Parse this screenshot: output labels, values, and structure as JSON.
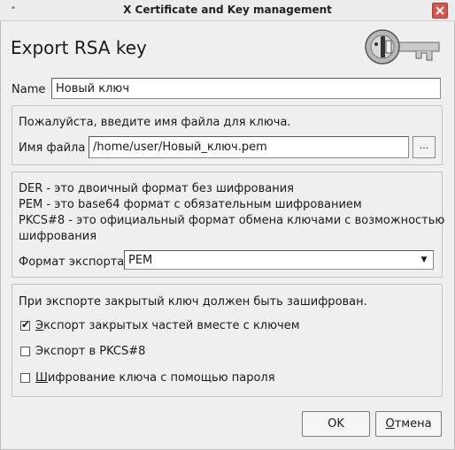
{
  "window": {
    "title": "X Certificate and Key management"
  },
  "dialog": {
    "heading": "Export RSA key"
  },
  "name": {
    "label": "Name",
    "value": "Новый ключ"
  },
  "file": {
    "prompt": "Пожалуйста, введите имя файла для ключа.",
    "label": "Имя файла",
    "value": "/home/user/Новый_ключ.pem",
    "browse_label": "..."
  },
  "format": {
    "desc_der": "DER - это двоичный формат без шифрования",
    "desc_pem": "PEM - это base64 формат с обязательным шифрованием",
    "desc_pkcs8_line1": "PKCS#8 - это официальный формат обмена ключами с возможностью",
    "desc_pkcs8_line2": "шифрования",
    "label": "Формат экспорта",
    "selected": "PEM"
  },
  "options": {
    "note": "При экспорте закрытый ключ должен быть зашифрован.",
    "export_private": {
      "label_first": "Э",
      "label_rest": "кспорт закрытых частей вместе с ключем",
      "checked": true
    },
    "export_pkcs8": {
      "label": "Экспорт в PKCS#8",
      "checked": false
    },
    "encrypt_password": {
      "label_first": "Ш",
      "label_rest": "ифрование ключа с помощью пароля",
      "checked": false
    }
  },
  "buttons": {
    "ok": "OK",
    "cancel_first": "О",
    "cancel_rest": "тмена"
  },
  "icons": {
    "window_menu": "window-menu-dot-icon",
    "close": "close-icon",
    "logo": "key-icon"
  },
  "colors": {
    "close": "#d9534f"
  }
}
